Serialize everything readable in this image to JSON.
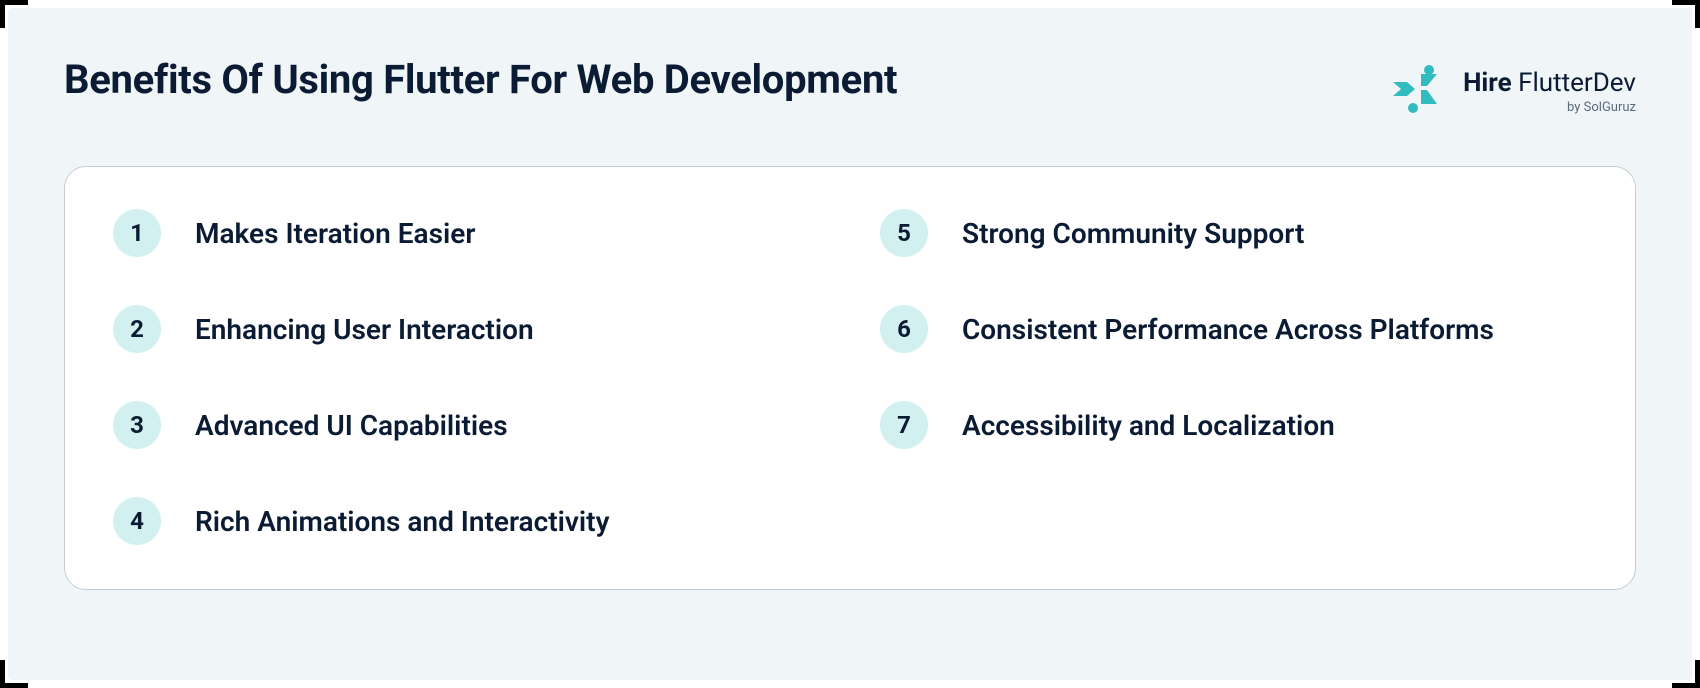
{
  "title": "Benefits Of Using Flutter For Web Development",
  "brand": {
    "main_bold": "Hire",
    "main_light": "FlutterDev",
    "sub": "by SolGuruz"
  },
  "benefits": {
    "left": [
      {
        "n": "1",
        "label": "Makes Iteration Easier"
      },
      {
        "n": "2",
        "label": "Enhancing User Interaction"
      },
      {
        "n": "3",
        "label": "Advanced UI Capabilities"
      },
      {
        "n": "4",
        "label": "Rich Animations and Interactivity"
      }
    ],
    "right": [
      {
        "n": "5",
        "label": "Strong Community Support"
      },
      {
        "n": "6",
        "label": "Consistent Performance Across Platforms"
      },
      {
        "n": "7",
        "label": "Accessibility and Localization"
      }
    ]
  },
  "colors": {
    "page_bg": "#f0f6f8",
    "text": "#0a1b33",
    "bullet_bg": "#d2f0f0",
    "card_border": "#c7ccd1",
    "brand_accent": "#32bcc0"
  }
}
